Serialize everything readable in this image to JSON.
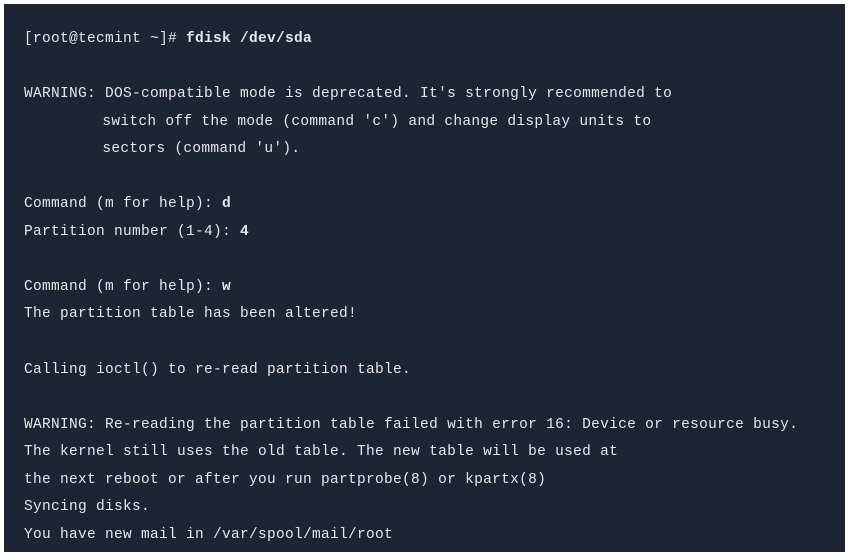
{
  "terminal": {
    "prompt": "[root@tecmint ~]# ",
    "command": "fdisk /dev/sda",
    "warning1_line1": "WARNING: DOS-compatible mode is deprecated. It's strongly recommended to",
    "warning1_line2": "switch off the mode (command 'c') and change display units to",
    "warning1_line3": "sectors (command 'u').",
    "cmd_prompt1": "Command (m for help): ",
    "cmd_input1": "d",
    "partition_prompt": "Partition number (1-4): ",
    "partition_input": "4",
    "cmd_prompt2": "Command (m for help): ",
    "cmd_input2": "w",
    "altered_msg": "The partition table has been altered!",
    "ioctl_msg": "Calling ioctl() to re-read partition table.",
    "warning2_line1": "WARNING: Re-reading the partition table failed with error 16: Device or resource busy.",
    "warning2_line2": "The kernel still uses the old table. The new table will be used at",
    "warning2_line3": "the next reboot or after you run partprobe(8) or kpartx(8)",
    "syncing_msg": "Syncing disks.",
    "mail_msg": "You have new mail in /var/spool/mail/root"
  }
}
